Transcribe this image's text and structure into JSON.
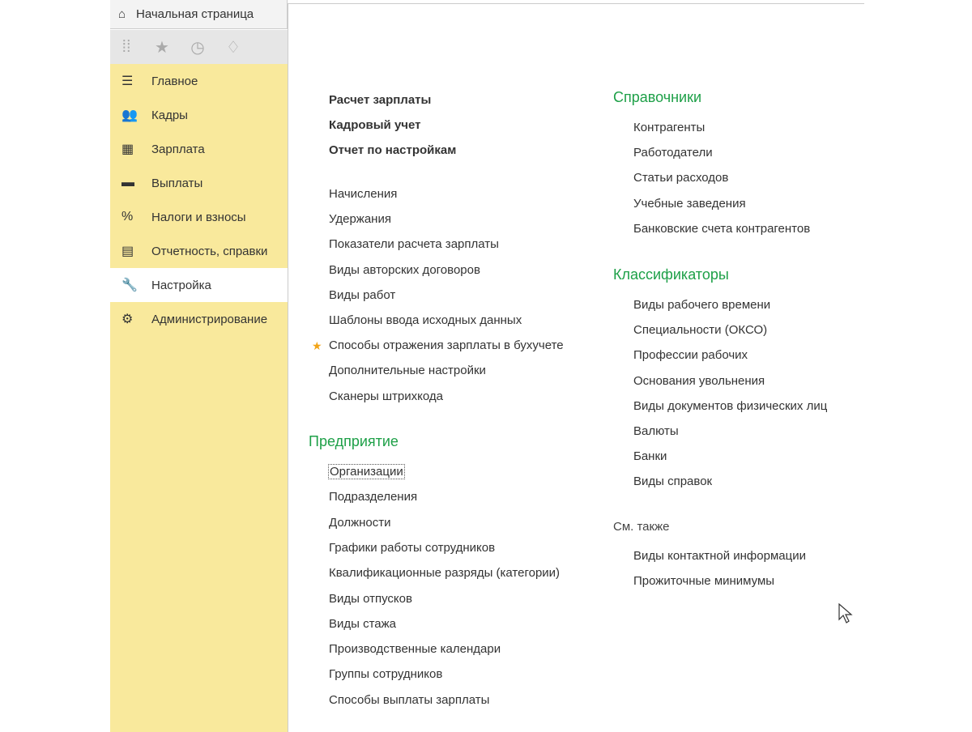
{
  "tab": {
    "label": "Начальная страница"
  },
  "sidebar": {
    "items": [
      {
        "label": "Главное",
        "icon": "menu-icon"
      },
      {
        "label": "Кадры",
        "icon": "users-icon"
      },
      {
        "label": "Зарплата",
        "icon": "calculator-icon"
      },
      {
        "label": "Выплаты",
        "icon": "card-icon"
      },
      {
        "label": "Налоги и взносы",
        "icon": "percent-icon"
      },
      {
        "label": "Отчетность, справки",
        "icon": "reports-icon"
      },
      {
        "label": "Настройка",
        "icon": "wrench-icon",
        "active": true
      },
      {
        "label": "Администрирование",
        "icon": "gear-icon"
      }
    ]
  },
  "main": {
    "bold_links": [
      "Расчет зарплаты",
      "Кадровый учет",
      "Отчет по настройкам"
    ],
    "links": [
      "Начисления",
      "Удержания",
      "Показатели расчета зарплаты",
      "Виды авторских договоров",
      "Виды работ",
      "Шаблоны ввода исходных данных",
      "Способы отражения зарплаты в бухучете",
      "Дополнительные настройки",
      "Сканеры штрихкода"
    ],
    "enterprise": {
      "title": "Предприятие",
      "items": [
        "Организации",
        "Подразделения",
        "Должности",
        "Графики работы сотрудников",
        "Квалификационные разряды (категории)",
        "Виды отпусков",
        "Виды стажа",
        "Производственные календари",
        "Группы сотрудников",
        "Способы выплаты зарплаты"
      ]
    },
    "directories": {
      "title": "Справочники",
      "items": [
        "Контрагенты",
        "Работодатели",
        "Статьи расходов",
        "Учебные заведения",
        "Банковские счета контрагентов"
      ]
    },
    "classifiers": {
      "title": "Классификаторы",
      "items": [
        "Виды рабочего времени",
        "Специальности (ОКСО)",
        "Профессии рабочих",
        "Основания увольнения",
        "Виды документов физических лиц",
        "Валюты",
        "Банки",
        "Виды справок"
      ]
    },
    "see_also": {
      "title": "См. также",
      "items": [
        "Виды контактной информации",
        "Прожиточные минимумы"
      ]
    }
  }
}
